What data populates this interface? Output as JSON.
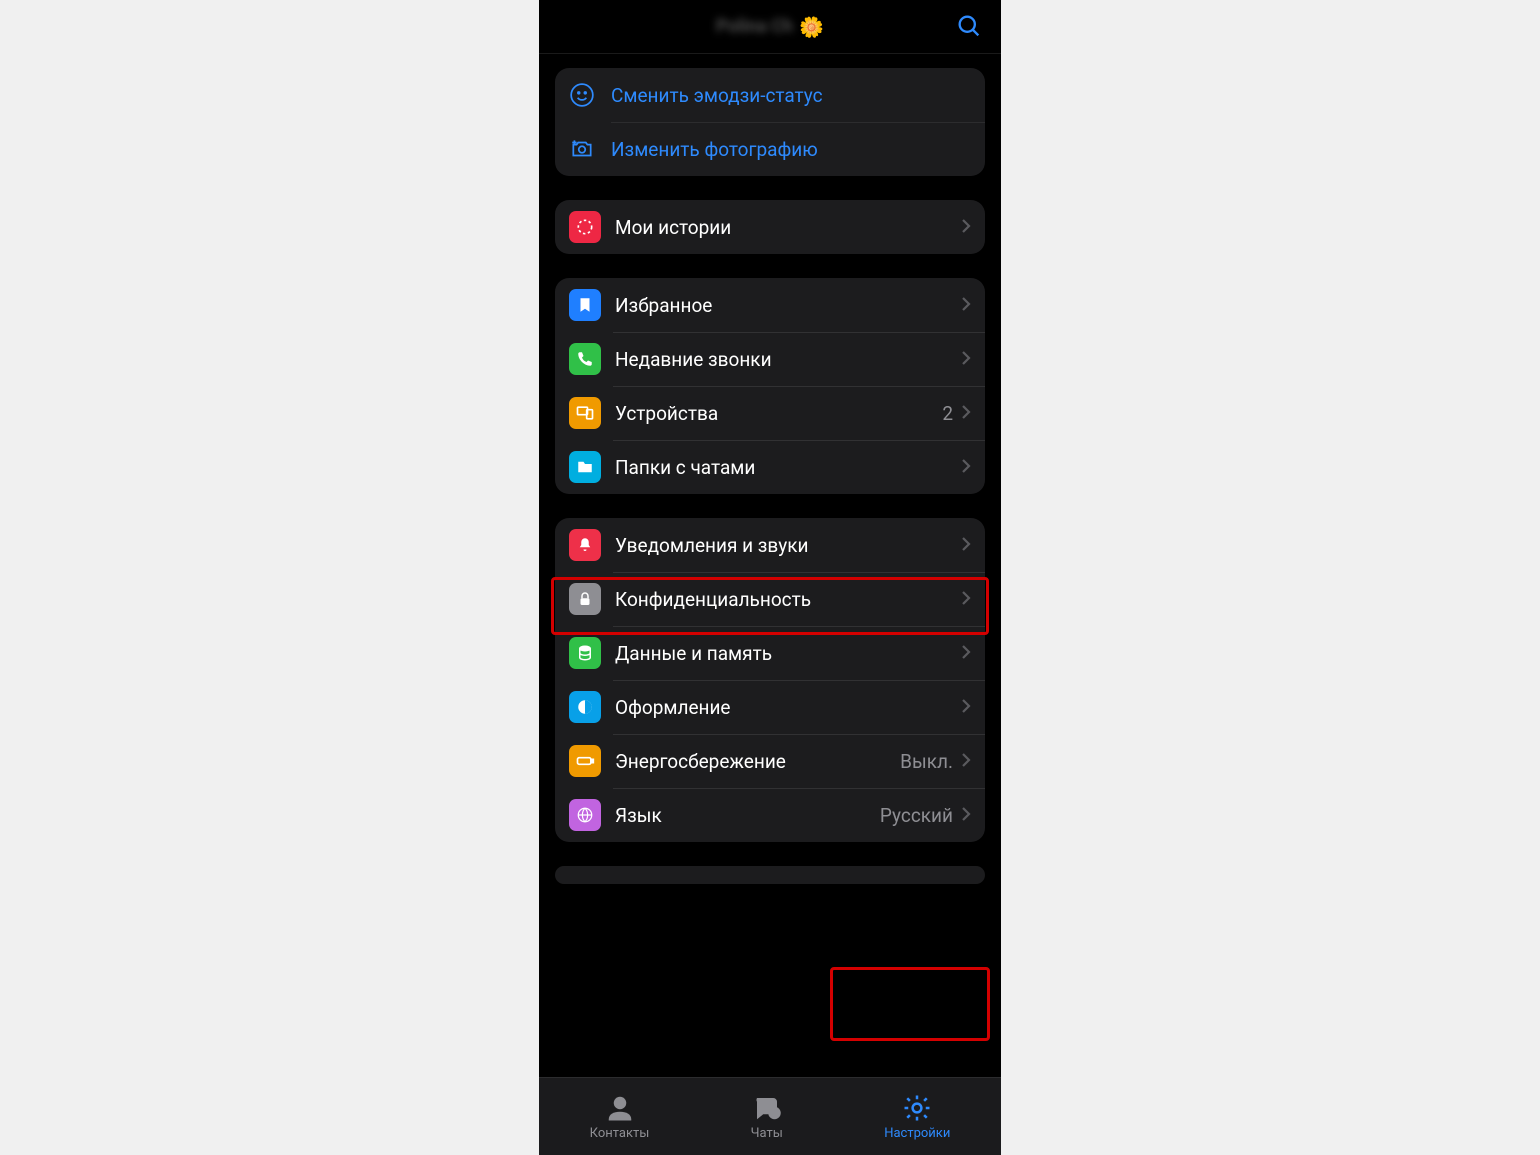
{
  "header": {
    "title_hidden": "Polina Ch"
  },
  "links": {
    "emoji_status": "Сменить эмодзи-статус",
    "change_photo": "Изменить фотографию"
  },
  "group_stories": {
    "my_stories": "Мои истории"
  },
  "group_chats": {
    "favorites": "Избранное",
    "recent_calls": "Недавние звонки",
    "devices": "Устройства",
    "devices_count": "2",
    "chat_folders": "Папки с чатами"
  },
  "group_settings": {
    "notifications": "Уведомления и звуки",
    "privacy": "Конфиденциальность",
    "data": "Данные и память",
    "appearance": "Оформление",
    "power": "Энергосбережение",
    "power_value": "Выкл.",
    "language": "Язык",
    "language_value": "Русский"
  },
  "tabs": {
    "contacts": "Контакты",
    "chats": "Чаты",
    "settings": "Настройки"
  },
  "colors": {
    "stories": "#ee2744",
    "favorites": "#1f7fff",
    "calls": "#30c048",
    "devices": "#f09a00",
    "folders": "#00aee0",
    "notifications": "#ee3049",
    "privacy": "#8e8e93",
    "data": "#30c048",
    "appearance": "#08a0e8",
    "power": "#f09a00",
    "language": "#c164e0"
  }
}
